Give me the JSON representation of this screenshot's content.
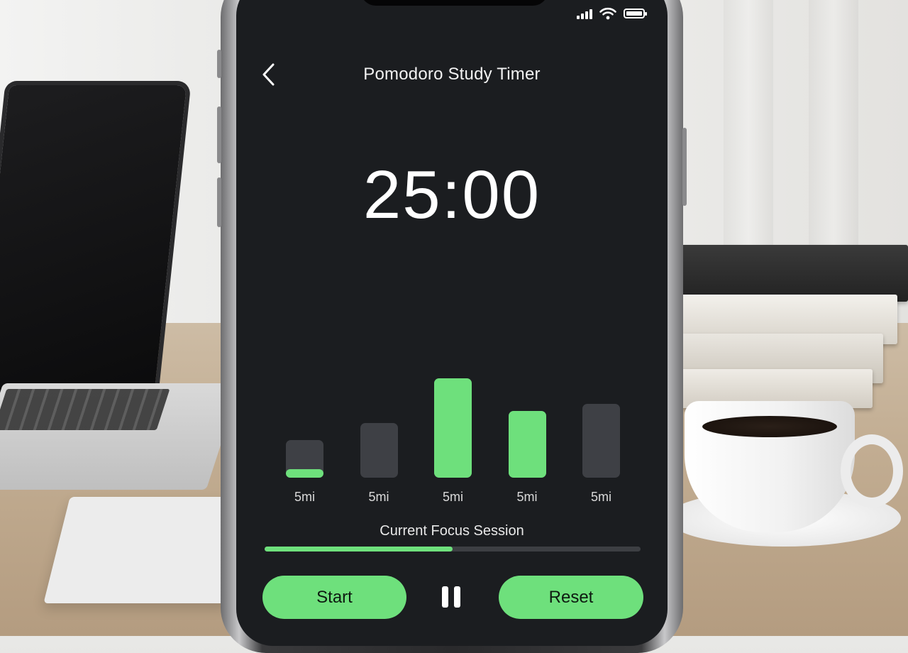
{
  "app": {
    "title": "Pomodoro Study Timer"
  },
  "status_bar": {
    "icons": [
      "signal-icon",
      "wifi-icon",
      "battery-icon"
    ]
  },
  "timer": {
    "display": "25:00"
  },
  "session_bars": [
    {
      "label": "5mi",
      "fill": 0.2,
      "level": 0.37
    },
    {
      "label": "5mi",
      "fill": 0,
      "level": 0.54
    },
    {
      "label": "5mi",
      "fill": 1,
      "level": 0.98
    },
    {
      "label": "5mi",
      "fill": 1,
      "level": 0.66
    },
    {
      "label": "5mi",
      "fill": 0,
      "level": 0.73
    }
  ],
  "session": {
    "label": "Current Focus Session",
    "progress": 0.5
  },
  "controls": {
    "start_label": "Start",
    "reset_label": "Reset",
    "pause_icon": "pause-icon"
  },
  "colors": {
    "accent": "#6ee07c",
    "screen_bg": "#1b1d20",
    "bar_inactive": "#3e4045"
  }
}
